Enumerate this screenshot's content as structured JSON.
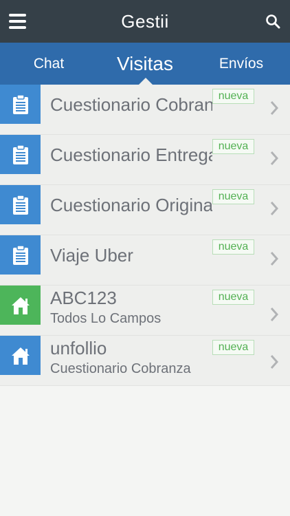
{
  "header": {
    "title": "Gestii",
    "menu_icon": "hamburger-menu-icon",
    "search_icon": "search-icon"
  },
  "tabs": [
    {
      "label": "Chat",
      "active": false
    },
    {
      "label": "Visitas",
      "active": true
    },
    {
      "label": "Envíos",
      "active": false
    }
  ],
  "items": [
    {
      "title": "Cuestionario Cobranza",
      "subtitle": "",
      "badge": "nueva",
      "icon": "clipboard-icon",
      "color": "#3f8ad1"
    },
    {
      "title": "Cuestionario Entrega",
      "subtitle": "",
      "badge": "nueva",
      "icon": "clipboard-icon",
      "color": "#3f8ad1"
    },
    {
      "title": "Cuestionario Original",
      "subtitle": "",
      "badge": "nueva",
      "icon": "clipboard-icon",
      "color": "#3f8ad1"
    },
    {
      "title": "Viaje Uber",
      "subtitle": "",
      "badge": "nueva",
      "icon": "clipboard-icon",
      "color": "#3f8ad1"
    },
    {
      "title": "ABC123",
      "subtitle": "Todos Lo Campos",
      "badge": "nueva",
      "icon": "home-icon",
      "color": "#4db55a"
    },
    {
      "title": "unfollio",
      "subtitle": "Cuestionario Cobranza",
      "badge": "nueva",
      "icon": "home-icon",
      "color": "#3f8ad1"
    }
  ],
  "colors": {
    "header_bg": "#354048",
    "tabbar_bg": "#2f6bab",
    "badge_text": "#53b153"
  }
}
